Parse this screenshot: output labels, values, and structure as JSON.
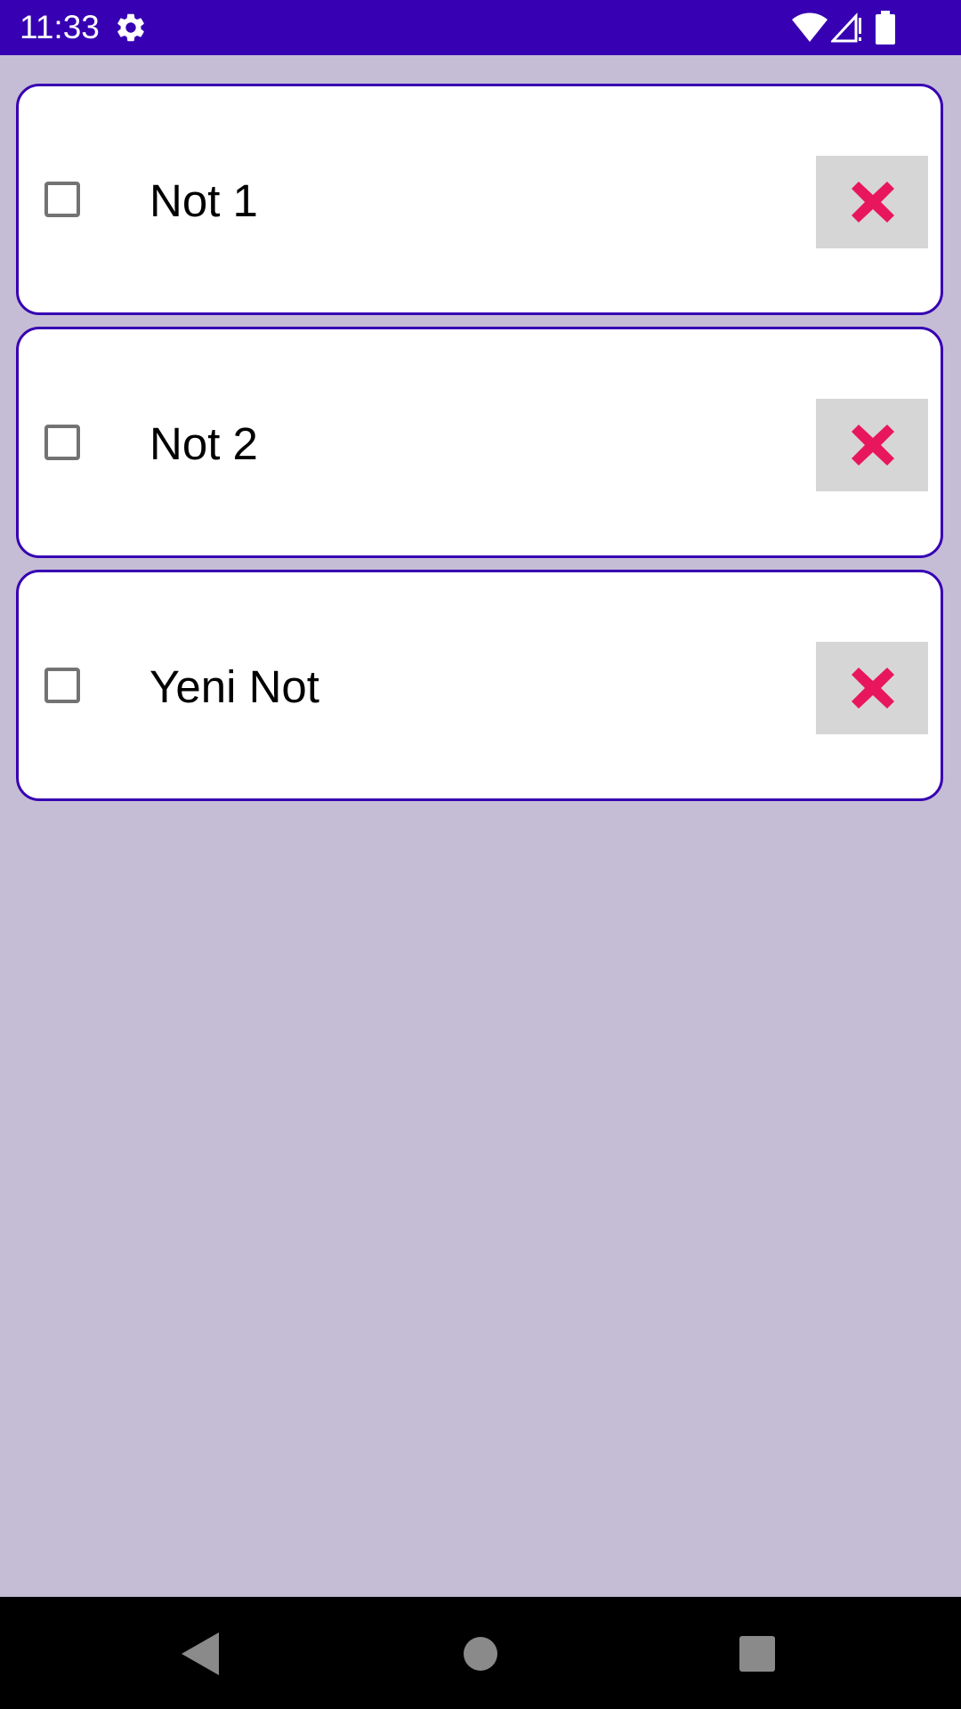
{
  "status_bar": {
    "time": "11:33",
    "background": "#3700b3",
    "icons": [
      "gear-icon",
      "wifi-icon",
      "signal-icon",
      "battery-icon"
    ]
  },
  "notes": [
    {
      "label": "Not 1",
      "checked": false
    },
    {
      "label": "Not 2",
      "checked": false
    },
    {
      "label": "Yeni Not",
      "checked": false
    }
  ],
  "colors": {
    "background": "#c5bdd5",
    "card_border": "#3700b3",
    "delete_icon": "#e8175d",
    "delete_button_bg": "#d6d6d6"
  },
  "nav_bar": {
    "icons": [
      "back-icon",
      "home-icon",
      "recents-icon"
    ]
  }
}
